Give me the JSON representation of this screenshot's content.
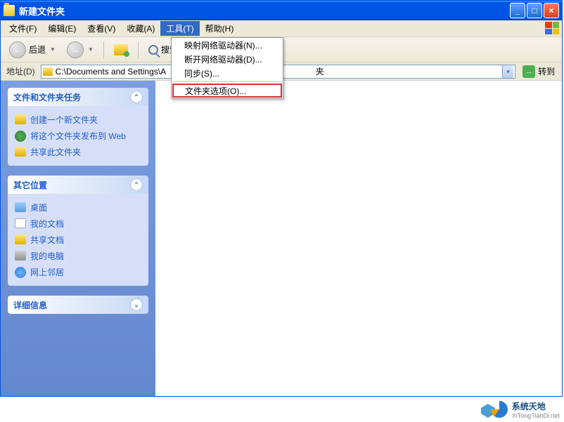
{
  "titlebar": {
    "title": "新建文件夹",
    "min_label": "_",
    "max_label": "□",
    "close_label": "×"
  },
  "menubar": {
    "items": [
      {
        "label": "文件(F)"
      },
      {
        "label": "编辑(E)"
      },
      {
        "label": "查看(V)"
      },
      {
        "label": "收藏(A)"
      },
      {
        "label": "工具(T)",
        "active": true
      },
      {
        "label": "帮助(H)"
      }
    ]
  },
  "toolbar": {
    "back_label": "后退",
    "search_label": "搜索"
  },
  "addressbar": {
    "label": "地址(D)",
    "path": "C:\\Documents and Settings\\A",
    "go_label": "转到"
  },
  "dropdown": {
    "items": [
      "映射网络驱动器(N)...",
      "断开网络驱动器(D)...",
      "同步(S)...",
      "文件夹选项(O)..."
    ],
    "highlight_index": 3
  },
  "sidebar": {
    "panel1": {
      "title": "文件和文件夹任务",
      "tasks": [
        "创建一个新文件夹",
        "将这个文件夹发布到 Web",
        "共享此文件夹"
      ]
    },
    "panel2": {
      "title": "其它位置",
      "places": [
        "桌面",
        "我的文档",
        "共享文档",
        "我的电脑",
        "网上邻居"
      ]
    },
    "panel3": {
      "title": "详细信息"
    }
  },
  "watermark": {
    "line1": "系统天地",
    "line2": "XiTongTianDi.net"
  },
  "addressbar_hidden_suffix": "夹"
}
